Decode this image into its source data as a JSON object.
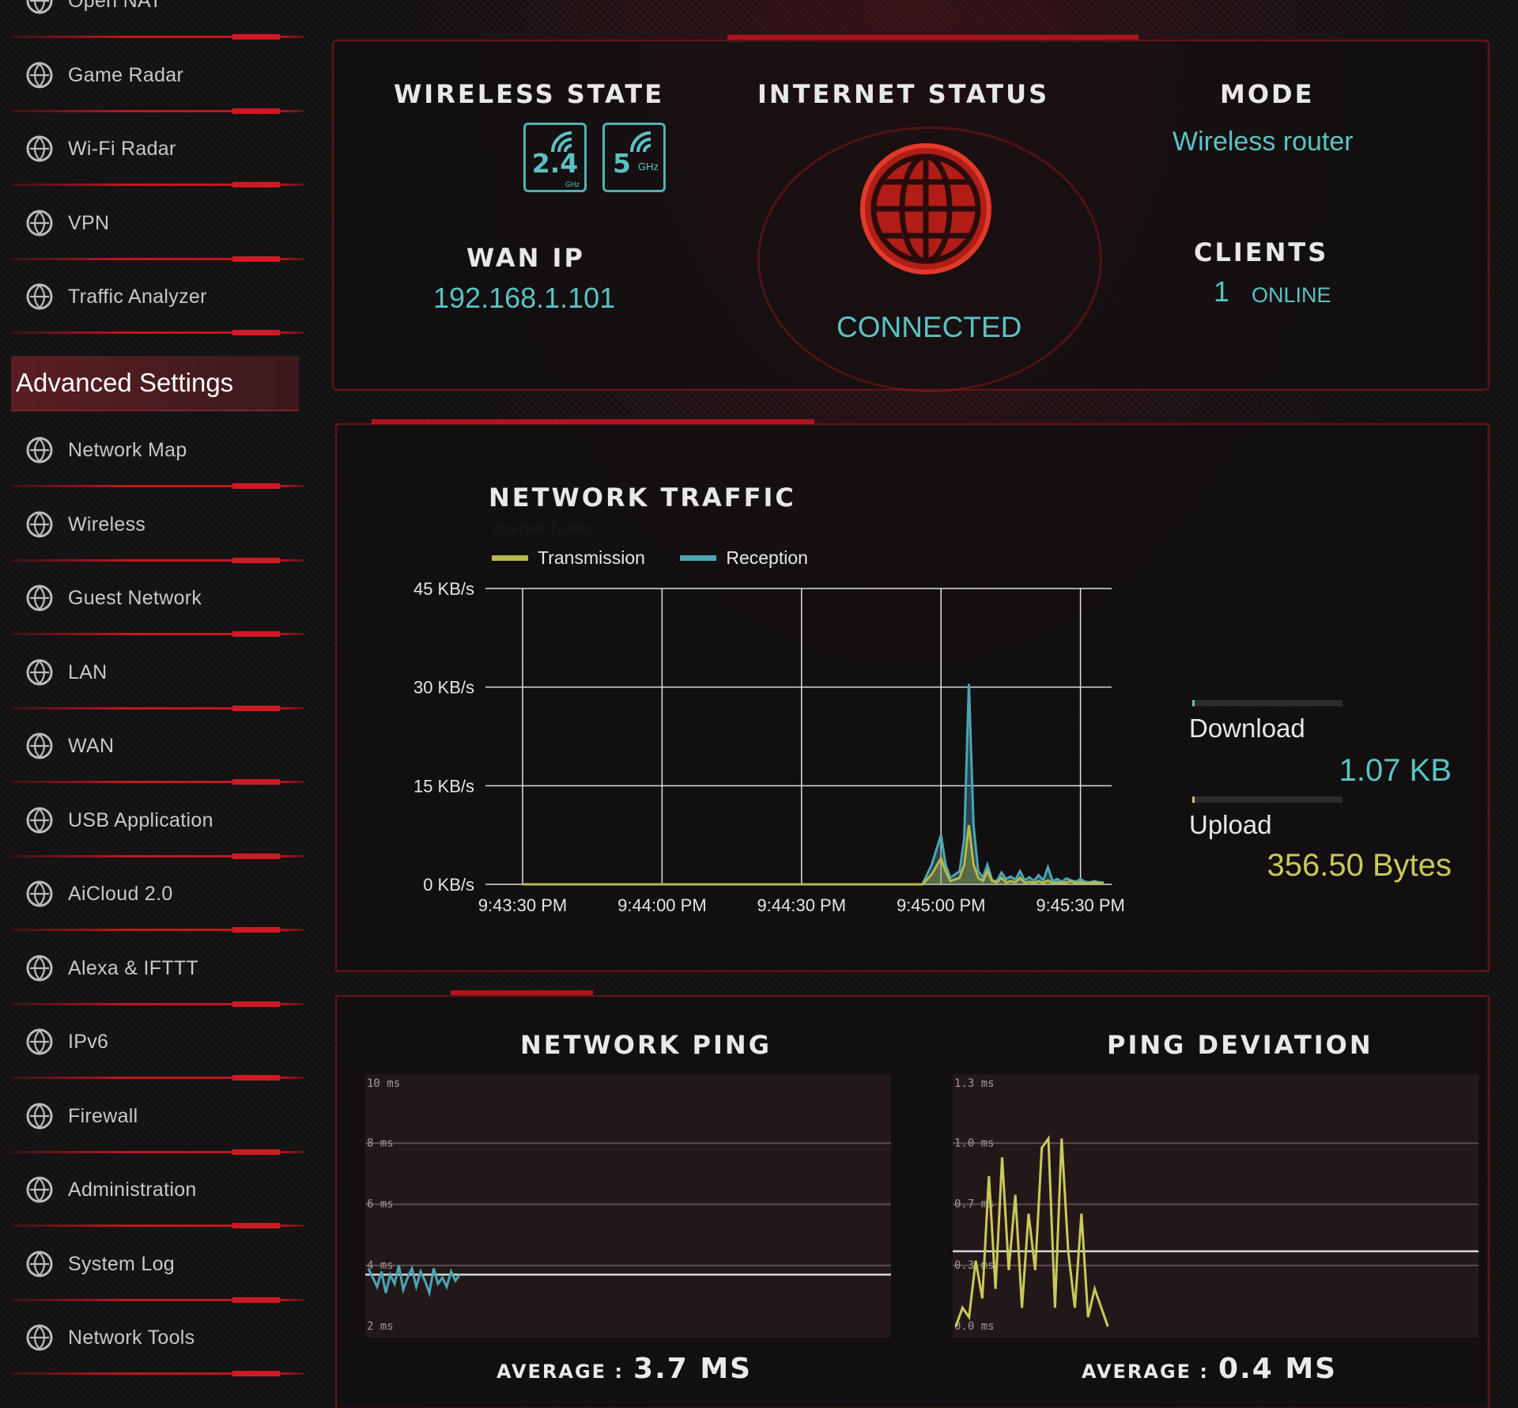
{
  "sidebar": {
    "items_top": [
      {
        "label": "Open NAT",
        "icon": "game-controller-icon"
      },
      {
        "label": "Game Radar",
        "icon": "radar-icon"
      },
      {
        "label": "Wi-Fi Radar",
        "icon": "wifi-radar-icon"
      },
      {
        "label": "VPN",
        "icon": "vpn-monitor-icon"
      },
      {
        "label": "Traffic Analyzer",
        "icon": "traffic-analyzer-icon"
      }
    ],
    "section_title": "Advanced Settings",
    "items": [
      {
        "label": "Network Map",
        "icon": "network-map-icon"
      },
      {
        "label": "Wireless",
        "icon": "wireless-icon"
      },
      {
        "label": "Guest Network",
        "icon": "guest-network-icon"
      },
      {
        "label": "LAN",
        "icon": "lan-icon"
      },
      {
        "label": "WAN",
        "icon": "wan-globe-icon"
      },
      {
        "label": "USB Application",
        "icon": "usb-icon"
      },
      {
        "label": "AiCloud 2.0",
        "icon": "cloud-icon"
      },
      {
        "label": "Alexa & IFTTT",
        "icon": "alexa-icon"
      },
      {
        "label": "IPv6",
        "icon": "ipv6-icon"
      },
      {
        "label": "Firewall",
        "icon": "firewall-icon"
      },
      {
        "label": "Administration",
        "icon": "gear-icon"
      },
      {
        "label": "System Log",
        "icon": "system-log-icon"
      },
      {
        "label": "Network Tools",
        "icon": "network-tools-icon"
      }
    ]
  },
  "status": {
    "wireless_state_title": "Wireless State",
    "band_24": "2.4",
    "band_24_sub": "GHz",
    "band_5": "5",
    "band_5_sub": "GHz",
    "internet_status_title": "Internet Status",
    "internet_status_value": "CONNECTED",
    "mode_title": "Mode",
    "mode_value": "Wireless router",
    "wan_ip_title": "WAN IP",
    "wan_ip_value": "192.168.1.101",
    "clients_title": "Clients",
    "clients_count": "1",
    "clients_suffix": "ONLINE"
  },
  "traffic": {
    "title": "Network Traffic",
    "subtitle": "Internet Traffic",
    "download_label": "Download",
    "download_value": "1.07 KB",
    "upload_label": "Upload",
    "upload_value": "356.50 Bytes"
  },
  "ping": {
    "ping_title": "Network Ping",
    "ping_avg_label": "Average :",
    "ping_avg_value": "3.7 MS",
    "deviation_title": "Ping Deviation",
    "deviation_avg_label": "Average :",
    "deviation_avg_value": "0.4 MS"
  },
  "colors": {
    "accent_red": "#c4161f",
    "teal": "#5bc3c4",
    "yellow": "#c9c95a",
    "transmission": "#b8b84a",
    "reception": "#4aa6b4"
  },
  "chart_data": [
    {
      "type": "area",
      "title": "Network Traffic",
      "x": [
        "9:43:30 PM",
        "9:44:00 PM",
        "9:44:30 PM",
        "9:45:00 PM",
        "9:45:30 PM"
      ],
      "ylim": [
        0,
        45
      ],
      "yticks": [
        "0 KB/s",
        "15 KB/s",
        "30 KB/s",
        "45 KB/s"
      ],
      "legend": "top-left",
      "grid": true,
      "series": [
        {
          "name": "Transmission",
          "color": "#b8b84a",
          "points_t": [
            0,
            86,
            88,
            90,
            91,
            92,
            94,
            95,
            96,
            97,
            98,
            99,
            100,
            101,
            102,
            103,
            104,
            105,
            106,
            107,
            108,
            109,
            110,
            111,
            112,
            113,
            114,
            115,
            116,
            117,
            118,
            119,
            120,
            121,
            122,
            123,
            124,
            125
          ],
          "values": [
            0,
            0,
            1.5,
            4,
            2,
            0.5,
            1,
            3,
            9,
            3,
            1,
            0.5,
            2,
            0.5,
            0.3,
            1,
            0.3,
            0.5,
            0.3,
            1,
            0.2,
            0.4,
            0.2,
            0.5,
            0.2,
            0.6,
            0.2,
            0.3,
            0.2,
            0.3,
            0.5,
            0.2,
            0.3,
            0.2,
            0.2,
            0.3,
            0.2,
            0.2
          ]
        },
        {
          "name": "Reception",
          "color": "#4aa6b4",
          "points_t": [
            0,
            86,
            88,
            90,
            91,
            92,
            94,
            95,
            96,
            97,
            98,
            99,
            100,
            101,
            102,
            103,
            104,
            105,
            106,
            107,
            108,
            109,
            110,
            111,
            112,
            113,
            114,
            115,
            116,
            117,
            118,
            119,
            120,
            121,
            122,
            123,
            124,
            125
          ],
          "values": [
            0,
            0,
            3,
            7.5,
            3,
            1,
            2,
            7,
            30.5,
            9,
            2,
            1,
            3,
            0.6,
            0.5,
            1.8,
            0.8,
            1.2,
            0.7,
            2,
            0.6,
            1.1,
            0.5,
            1.4,
            0.6,
            2.6,
            0.5,
            0.8,
            0.4,
            0.9,
            0.6,
            0.4,
            0.8,
            0.4,
            0.3,
            0.5,
            0.3,
            0.3
          ]
        }
      ]
    },
    {
      "type": "line",
      "title": "Network Ping",
      "ylim": [
        2,
        10
      ],
      "yticks": [
        "2 ms",
        "4 ms",
        "6 ms",
        "8 ms",
        "10 ms"
      ],
      "average": 3.7,
      "series": [
        {
          "color": "#4aa6b4",
          "values": [
            3.9,
            3.6,
            3.3,
            3.8,
            3.1,
            3.7,
            3.4,
            4.0,
            3.2,
            3.6,
            3.9,
            3.3,
            3.8,
            3.5,
            3.1,
            3.9,
            3.4,
            3.6,
            3.3,
            3.8,
            3.5,
            3.7
          ]
        }
      ]
    },
    {
      "type": "line",
      "title": "Ping Deviation",
      "ylim": [
        0,
        1.3
      ],
      "yticks": [
        "0.0 ms",
        "0.3 ms",
        "0.7 ms",
        "1.0 ms",
        "1.3 ms"
      ],
      "average": 0.4,
      "series": [
        {
          "color": "#c9c95a",
          "values": [
            0.0,
            0.1,
            0.05,
            0.35,
            0.15,
            0.8,
            0.2,
            0.9,
            0.3,
            0.7,
            0.1,
            0.6,
            0.3,
            0.95,
            1.0,
            0.1,
            1.0,
            0.4,
            0.1,
            0.6,
            0.05,
            0.2,
            0.1,
            0.0
          ]
        }
      ]
    }
  ]
}
